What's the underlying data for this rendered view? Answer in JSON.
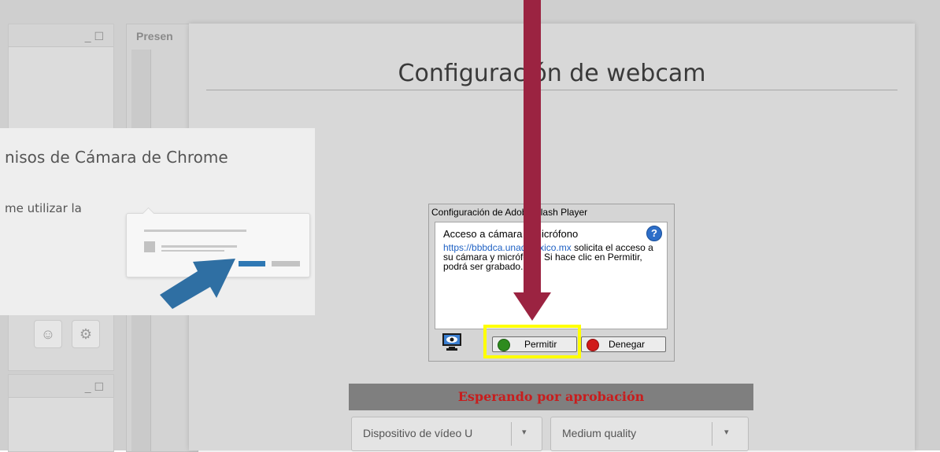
{
  "background": {
    "presentation_tab_label": "Presen",
    "window_control": "_ ☐"
  },
  "modal": {
    "title": "Configuración de webcam",
    "status": "Esperando por aprobación",
    "video_select": "Dispositivo de vídeo U",
    "quality_select": "Medium quality",
    "caret": "▾"
  },
  "chrome_permission": {
    "title": "nisos de Cámara de Chrome",
    "text": "me utilizar la"
  },
  "flash_dialog": {
    "title": "Configuración de Adobe Flash Player",
    "heading": "Acceso a cámara y micrófono",
    "help": "?",
    "link": "https://bbbdca.unadmexico.mx",
    "message": " solicita el acceso a su cámara y micrófono. Si hace clic en Permitir, podrá ser grabado.",
    "allow_label": "Permitir",
    "deny_label": "Denegar"
  },
  "colors": {
    "arrow": "#9b2341",
    "highlight": "#ffff00",
    "status_text": "#c81d1d",
    "link": "#2062c4",
    "illustration_arrow": "#2f6fa3"
  },
  "icons": [
    "eye-monitor-icon",
    "check-icon",
    "deny-icon",
    "smiley-icon",
    "gear-icon",
    "arrow-down-icon"
  ]
}
